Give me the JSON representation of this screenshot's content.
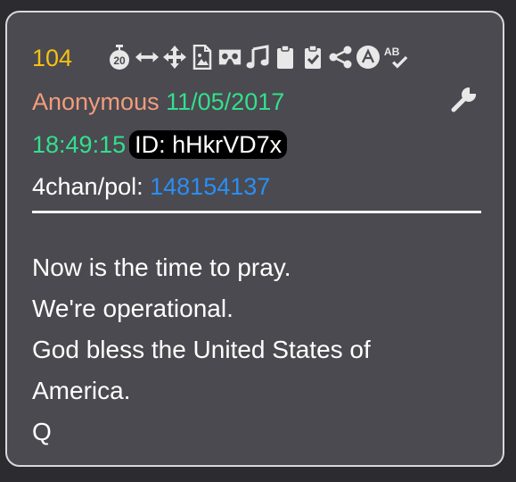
{
  "post": {
    "number": "104",
    "author": "Anonymous",
    "date": "11/05/2017",
    "time": "18:49:15",
    "id_label": "ID: hHkrVD7x",
    "board": "4chan/pol:",
    "post_number": "148154137",
    "lines": [
      "Now is the time to pray.",
      "We're operational.",
      "God bless the United States of",
      "America.",
      "Q"
    ]
  },
  "toolbar": {
    "icons": [
      "timer-20-icon",
      "resize-horizontal-icon",
      "move-icon",
      "image-file-icon",
      "vr-goggles-icon",
      "music-icon",
      "clipboard-icon",
      "clipboard-check-icon",
      "share-icon",
      "font-a-icon",
      "spellcheck-icon"
    ],
    "timer_label": "20"
  },
  "colors": {
    "post_number": "#f7c10f",
    "author": "#f39c7d",
    "date": "#32e08c",
    "link": "#2a8ef5",
    "card_bg": "#4a4a50",
    "page_bg": "#2b2b30"
  }
}
